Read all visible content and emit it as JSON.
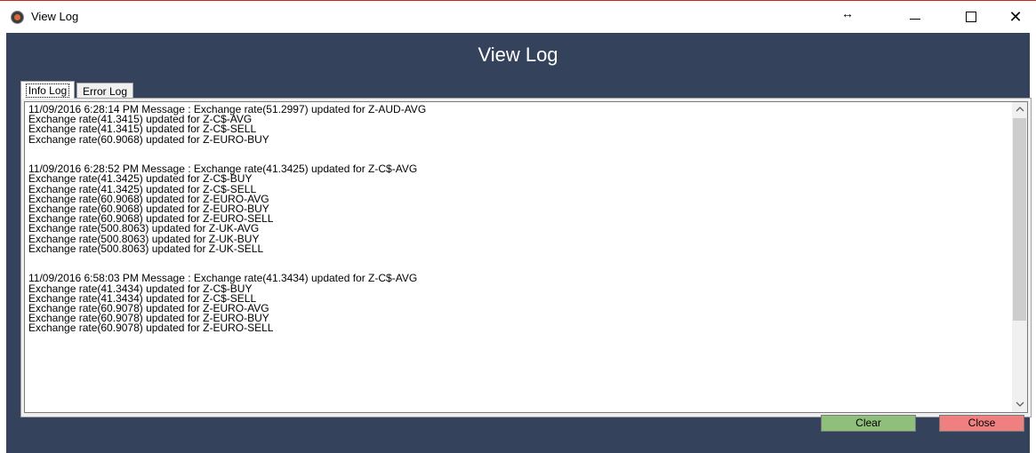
{
  "window": {
    "title": "View Log",
    "resize_glyph": "↔",
    "close_glyph": "✕"
  },
  "header": {
    "title": "View Log"
  },
  "tabs": [
    {
      "label": "Info Log",
      "selected": true
    },
    {
      "label": "Error Log",
      "selected": false
    }
  ],
  "log": {
    "text": "11/09/2016 6:28:14 PM Message : Exchange rate(51.2997) updated for Z-AUD-AVG\nExchange rate(41.3415) updated for Z-C$-AVG\nExchange rate(41.3415) updated for Z-C$-SELL\nExchange rate(60.9068) updated for Z-EURO-BUY\n\n\n11/09/2016 6:28:52 PM Message : Exchange rate(41.3425) updated for Z-C$-AVG\nExchange rate(41.3425) updated for Z-C$-BUY\nExchange rate(41.3425) updated for Z-C$-SELL\nExchange rate(60.9068) updated for Z-EURO-AVG\nExchange rate(60.9068) updated for Z-EURO-BUY\nExchange rate(60.9068) updated for Z-EURO-SELL\nExchange rate(500.8063) updated for Z-UK-AVG\nExchange rate(500.8063) updated for Z-UK-BUY\nExchange rate(500.8063) updated for Z-UK-SELL\n\n\n11/09/2016 6:58:03 PM Message : Exchange rate(41.3434) updated for Z-C$-AVG\nExchange rate(41.3434) updated for Z-C$-BUY\nExchange rate(41.3434) updated for Z-C$-SELL\nExchange rate(60.9078) updated for Z-EURO-AVG\nExchange rate(60.9078) updated for Z-EURO-BUY\nExchange rate(60.9078) updated for Z-EURO-SELL"
  },
  "scrollbar": {
    "up_icon": "chevron-up-icon",
    "down_icon": "chevron-down-icon"
  },
  "buttons": {
    "clear": "Clear",
    "close": "Close"
  },
  "colors": {
    "header_bg": "#34425c",
    "clear_bg": "#8fc07b",
    "close_bg": "#f08080"
  }
}
